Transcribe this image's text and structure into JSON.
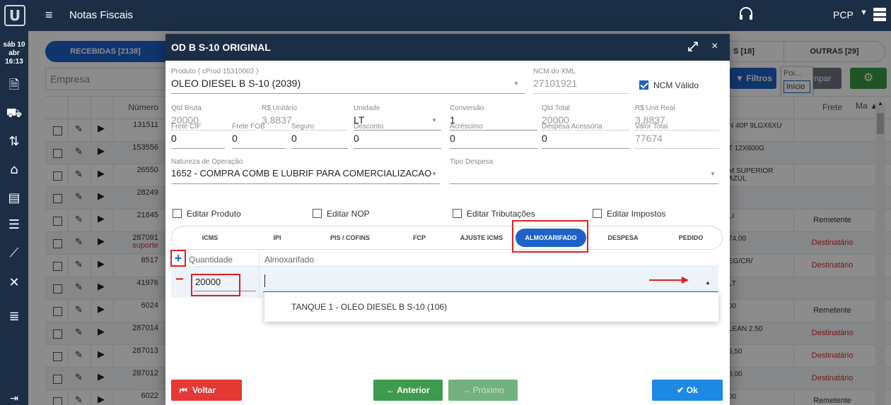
{
  "topbar": {
    "title": "Notas Fiscais",
    "user": "PCP",
    "logo_letter": "U"
  },
  "rail": {
    "date": "sáb 10 abr",
    "time": "16:13"
  },
  "bg": {
    "tab_received": "RECEBIDAS [2138]",
    "tab_partial": "S [18]",
    "tab_others": "OUTRAS [29]",
    "empresa_placeholder": "Empresa",
    "filtros": "Filtros",
    "limpar": "mpar",
    "tooltip_top": "Poi...",
    "tooltip_selected": "Início",
    "col_numero": "Número",
    "col_frete": "Frete",
    "col_ma": "Ma",
    "rows": [
      {
        "num": "131511",
        "sub": "",
        "right": "N 40P 9LGX6XU",
        "frete": ""
      },
      {
        "num": "153556",
        "sub": "",
        "right": "T 12X600G",
        "frete": ""
      },
      {
        "num": "26550",
        "sub": "",
        "right": "M SUPERIOR AZUL",
        "frete": ""
      },
      {
        "num": "28249",
        "sub": "",
        "right": "",
        "frete": ""
      },
      {
        "num": "21845",
        "sub": "",
        "right": "LI",
        "frete": "Remetente"
      },
      {
        "num": "287091",
        "sub": "suporte",
        "right": "74,00",
        "frete": "Destinatário"
      },
      {
        "num": "8517",
        "sub": "",
        "right": "EG/CR/",
        "frete": "Destinatário"
      },
      {
        "num": "41976",
        "sub": "",
        "right": "LT",
        "frete": ""
      },
      {
        "num": "6024",
        "sub": "",
        "right": "00",
        "frete": "Remetente"
      },
      {
        "num": "287014",
        "sub": "",
        "right": "LEAN 2,50",
        "frete": "Destinatário"
      },
      {
        "num": "287013",
        "sub": "",
        "right": "5,50",
        "frete": "Destinatário"
      },
      {
        "num": "287012",
        "sub": "",
        "right": "8,00",
        "frete": "Destinatário"
      },
      {
        "num": "6022",
        "sub": "",
        "right": "00",
        "frete": "Remetente"
      }
    ]
  },
  "modal": {
    "title": "OD B S-10 ORIGINAL",
    "produto_label": "Produto ( cProd 15310002 )",
    "produto_value": "OLEO DIESEL B S-10 (2039)",
    "ncm_label": "NCM do XML",
    "ncm_value": "27101921",
    "ncm_valido": "NCM Válido",
    "row1": [
      {
        "label": "Qtd Bruta",
        "value": "20000"
      },
      {
        "label": "R$ Unitário",
        "value": "3,8837"
      },
      {
        "label": "Unidade",
        "value": "LT"
      },
      {
        "label": "Conversão",
        "value": "1"
      },
      {
        "label": "Qtd Total",
        "value": "20000"
      },
      {
        "label": "R$ Unit Real",
        "value": "3,8837"
      }
    ],
    "row2": [
      {
        "label": "Frete CIF",
        "value": "0"
      },
      {
        "label": "Frete FOB",
        "value": "0"
      },
      {
        "label": "Seguro",
        "value": "0"
      },
      {
        "label": "Desconto",
        "value": "0"
      },
      {
        "label": "Acréscimo",
        "value": "0"
      },
      {
        "label": "Despesa Acessória",
        "value": "0"
      },
      {
        "label": "Valor Total",
        "value": "77674"
      }
    ],
    "natureza_label": "Natureza de Operação",
    "natureza_value": "1652 - COMPRA COMB E LUBRIF PARA COMERCIALIZACAO",
    "tipo_despesa_label": "Tipo Despesa",
    "checks": {
      "editar_produto": "Editar Produto",
      "editar_nop": "Editar NOP",
      "editar_tributacoes": "Editar Tributações",
      "editar_impostos": "Editar Impostos"
    },
    "tabs": [
      "ICMS",
      "IPI",
      "PIS / COFINS",
      "FCP",
      "AJUSTE ICMS",
      "ALMOXARIFADO",
      "DESPESA",
      "PEDIDO"
    ],
    "active_tab": "ALMOXARIFADO",
    "col_quantidade": "Quantidade",
    "col_almoxarifado": "Almoxarifado",
    "quantidade_value": "20000",
    "dropdown_option": "TANQUE 1 - OLEO DIESEL B S-10 (106)",
    "buttons": {
      "voltar": "Voltar",
      "anterior": "Anterior",
      "proximo": "Próximo",
      "ok": "Ok"
    }
  },
  "colors": {
    "header_bg": "#1b2e45",
    "primary": "#1e62c7",
    "danger": "#e53935",
    "success": "#3e9b4d",
    "highlight": "#e02020"
  }
}
